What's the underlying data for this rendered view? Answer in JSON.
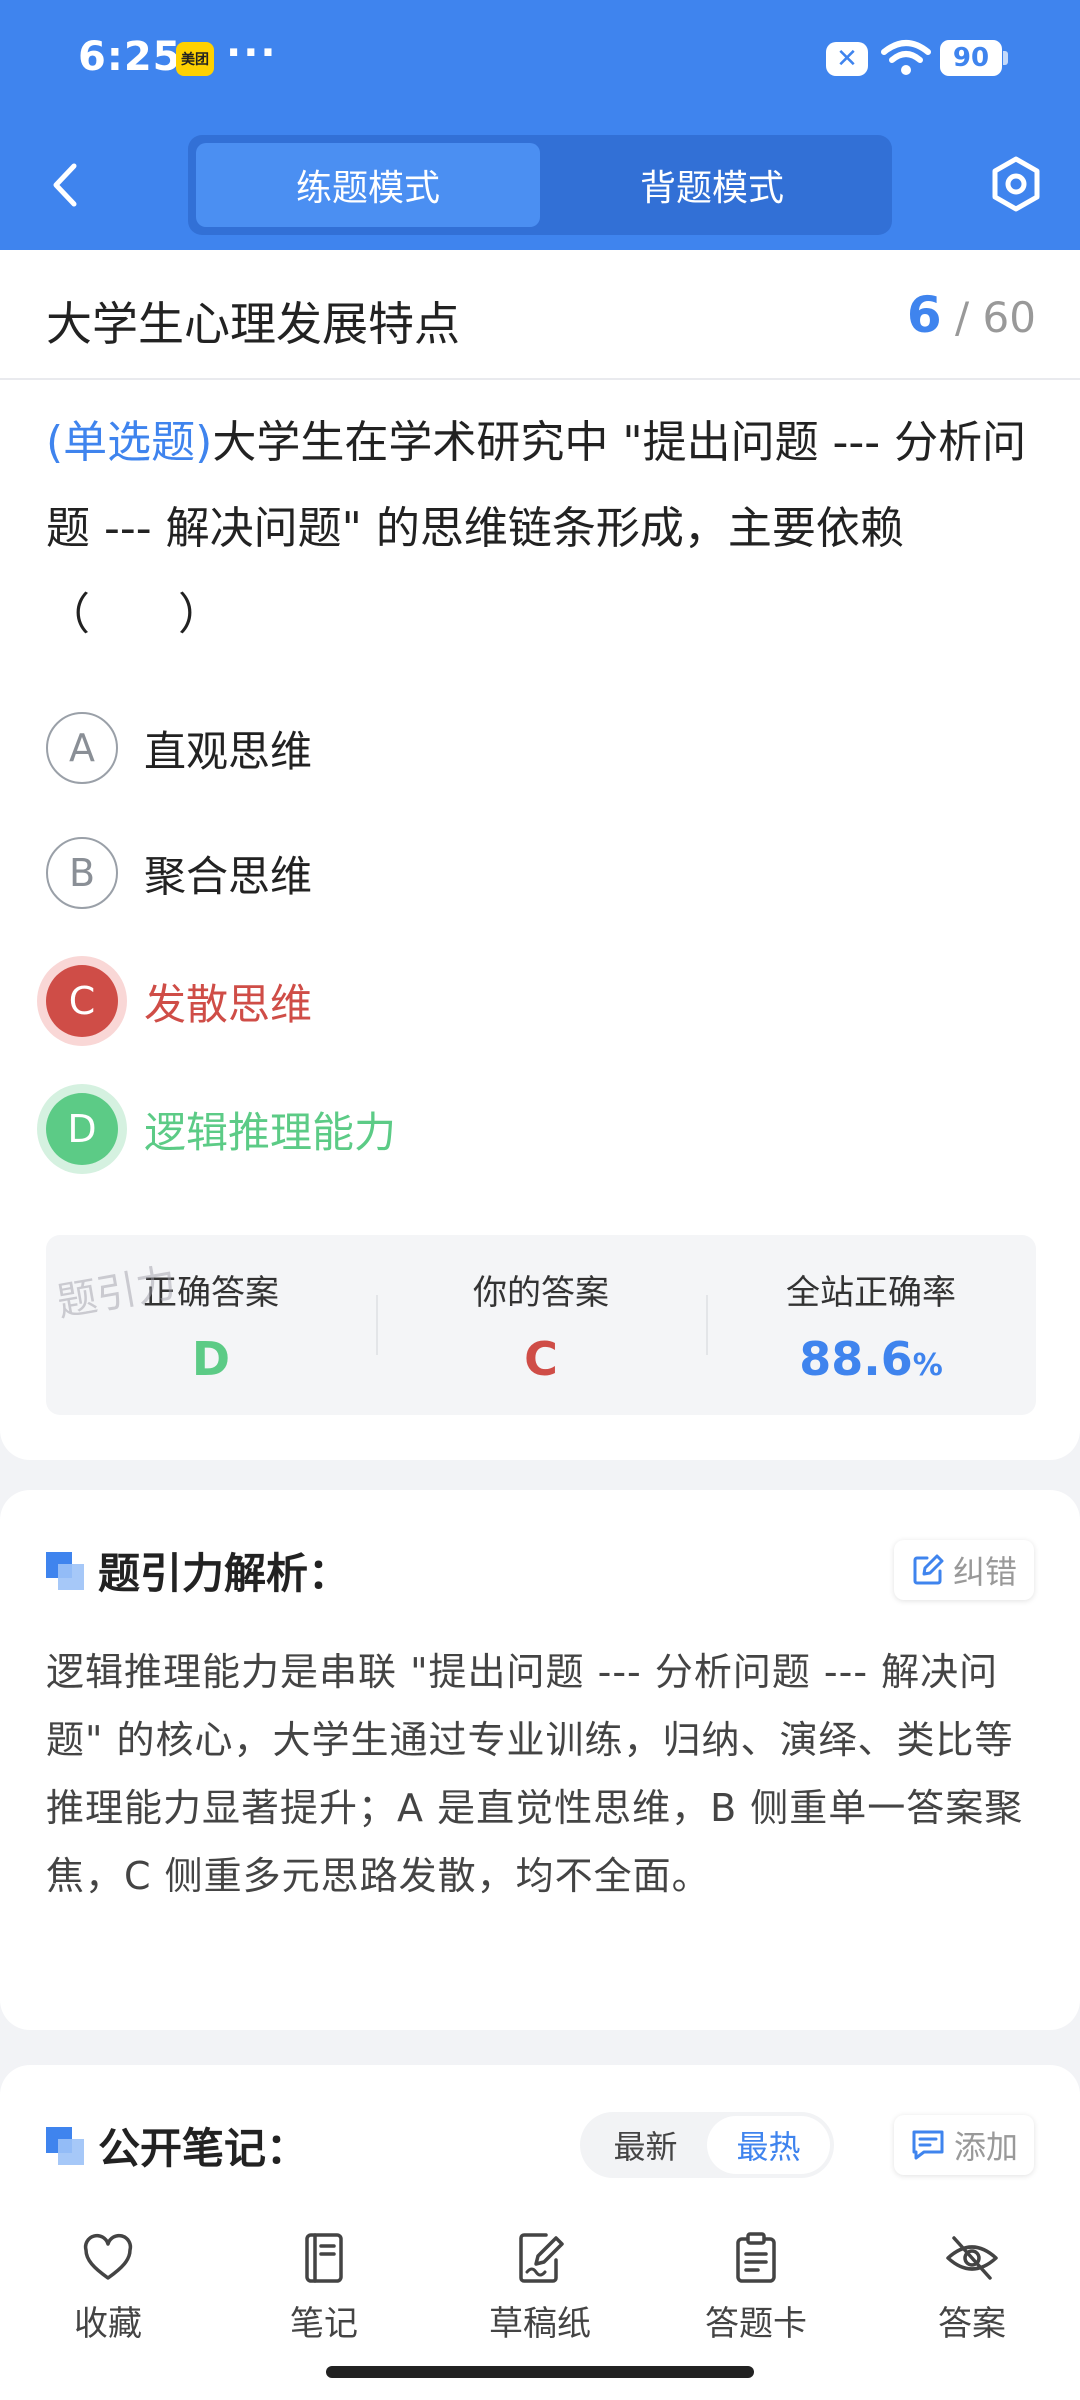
{
  "status": {
    "time": "6:25",
    "meituan": "美团",
    "dots": "···",
    "battery": "90",
    "x": "✕"
  },
  "nav": {
    "tabs": [
      {
        "label": "练题模式"
      },
      {
        "label": "背题模式"
      }
    ],
    "active_tab": 0
  },
  "title": {
    "topic": "大学生心理发展特点",
    "current": "6",
    "total": "60",
    "separator": "/"
  },
  "question": {
    "type": "(单选题)",
    "text": "大学生在学术研究中 \"提出问题 --- 分析问题 --- 解决问题\" 的思维链条形成，主要依赖（　　）",
    "options": [
      {
        "letter": "A",
        "text": "直观思维",
        "state": "normal"
      },
      {
        "letter": "B",
        "text": "聚合思维",
        "state": "normal"
      },
      {
        "letter": "C",
        "text": "发散思维",
        "state": "wrong"
      },
      {
        "letter": "D",
        "text": "逻辑推理能力",
        "state": "right"
      }
    ]
  },
  "answers": {
    "correct_label": "正确答案",
    "correct_value": "D",
    "yours_label": "你的答案",
    "yours_value": "C",
    "rate_label": "全站正确率",
    "rate_value": "88.6",
    "rate_unit": "%"
  },
  "watermark": "题引力",
  "analysis": {
    "title": "题引力解析：",
    "report_label": "纠错",
    "text": "逻辑推理能力是串联 \"提出问题 --- 分析问题 --- 解决问题\" 的核心，大学生通过专业训练，归纳、演绎、类比等推理能力显著提升；A 是直觉性思维，B 侧重单一答案聚焦，C 侧重多元思路发散，均不全面。"
  },
  "notes": {
    "title": "公开笔记：",
    "sort_options": [
      "最新",
      "最热"
    ],
    "add_label": "添加"
  },
  "bottom": {
    "items": [
      {
        "label": "收藏",
        "icon": "heart-icon"
      },
      {
        "label": "笔记",
        "icon": "notebook-icon"
      },
      {
        "label": "草稿纸",
        "icon": "draft-icon"
      },
      {
        "label": "答题卡",
        "icon": "answer-card-icon"
      },
      {
        "label": "答案",
        "icon": "eye-off-icon"
      }
    ]
  },
  "colors": {
    "primary": "#3f84ee",
    "wrong": "#cf4d47",
    "right": "#5ccb86"
  }
}
